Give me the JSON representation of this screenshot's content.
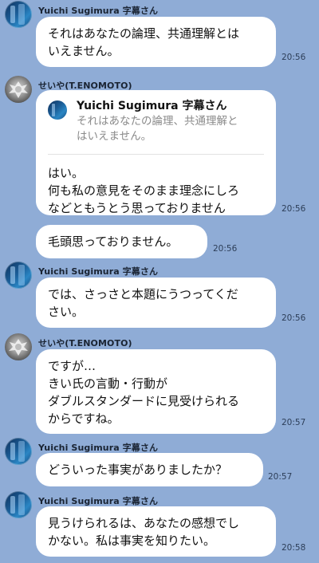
{
  "app": {
    "name": "chat-log"
  },
  "messages": [
    {
      "sender": "Yuichi Sugimura 字幕さん",
      "avatar_icon": "yuichi-avatar-icon",
      "text": "それはあなたの論理、共通理解とは\nいえません。",
      "time": "20:56"
    },
    {
      "sender": "せいや(T.ENOMOTO)",
      "avatar_icon": "seiya-avatar-icon",
      "reply_to": {
        "name": "Yuichi Sugimura 字幕さん",
        "text": "それはあなたの論理、共通理解と\nはいえません。"
      },
      "text": "はい。\n何も私の意見をそのまま理念にしろ\nなどともうとう思っておりません",
      "time": "20:56"
    },
    {
      "sender": "",
      "text": "毛頭思っておりません。",
      "time": "20:56"
    },
    {
      "sender": "Yuichi Sugimura 字幕さん",
      "avatar_icon": "yuichi-avatar-icon",
      "text": "では、さっさと本題にうつってくだ\nさい。",
      "time": "20:56"
    },
    {
      "sender": "せいや(T.ENOMOTO)",
      "avatar_icon": "seiya-avatar-icon",
      "text": "ですが…\nきい氏の言動・行動が\nダブルスタンダードに見受けられる\nからですね。",
      "time": "20:57"
    },
    {
      "sender": "Yuichi Sugimura 字幕さん",
      "avatar_icon": "yuichi-avatar-icon",
      "text": "どういった事実がありましたか？",
      "time": "20:57"
    },
    {
      "sender": "Yuichi Sugimura 字幕さん",
      "avatar_icon": "yuichi-avatar-icon",
      "text": "見うけられるは、あなたの感想でし\nかない。私は事実を知りたい。",
      "time": "20:58"
    }
  ],
  "colors": {
    "background": "#8facd6",
    "bubble": "#ffffff",
    "quote_text": "#8a8a8a"
  }
}
